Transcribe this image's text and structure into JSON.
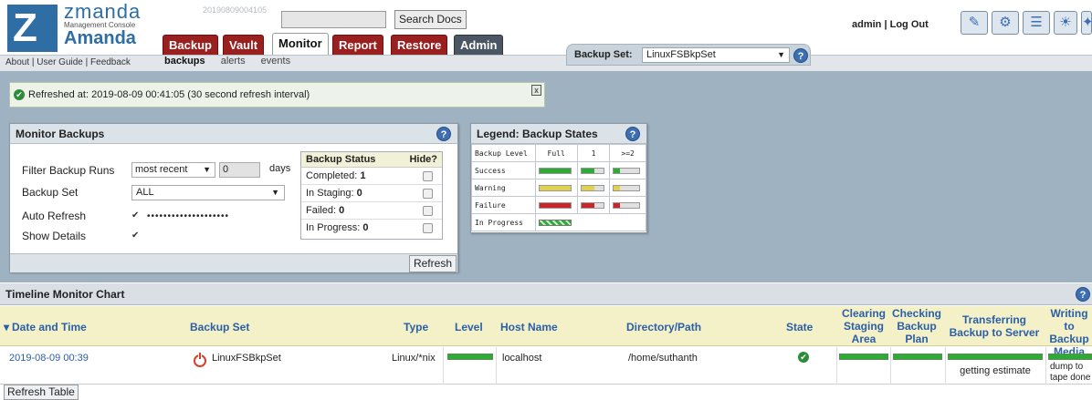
{
  "header": {
    "logo": {
      "line1": "zmanda",
      "line2": "Management Console",
      "line3": "Amanda"
    },
    "build_id": "20190809004105",
    "search_button": "Search Docs",
    "tabs": [
      "Backup",
      "Vault",
      "Monitor",
      "Report",
      "Restore",
      "Admin"
    ],
    "active_tab": "Monitor",
    "sublinks": "About | User Guide | Feedback",
    "subnav": [
      "backups",
      "alerts",
      "events"
    ],
    "backup_set_label": "Backup Set:",
    "backup_set_value": "LinuxFSBkpSet",
    "user_label": "admin",
    "separator": "|",
    "logout": "Log Out",
    "help_glyph": "?"
  },
  "refresh": {
    "message": "Refreshed at: 2019-08-09 00:41:05 (30 second refresh interval)",
    "close": "x"
  },
  "monitor": {
    "title": "Monitor Backups",
    "filter_label": "Filter Backup Runs",
    "filter_value": "most recent",
    "filter_days": "0",
    "days_label": "days",
    "backup_set_label": "Backup Set",
    "backup_set_value": "ALL",
    "auto_refresh_label": "Auto Refresh",
    "show_details_label": "Show Details",
    "masked": "••••••••••••••••••••",
    "status_header": "Backup Status",
    "hide_header": "Hide?",
    "status": [
      {
        "label": "Completed:",
        "value": "1"
      },
      {
        "label": "In Staging:",
        "value": "0"
      },
      {
        "label": "Failed:",
        "value": "0"
      },
      {
        "label": "In Progress:",
        "value": "0"
      }
    ],
    "refresh_button": "Refresh"
  },
  "legend": {
    "title": "Legend: Backup States",
    "col_level": "Backup Level",
    "col_full": "Full",
    "col_1": "1",
    "col_2": ">=2",
    "rows": [
      "Success",
      "Warning",
      "Failure",
      "In Progress"
    ],
    "colors": {
      "success": "#2eab34",
      "warning": "#e0d24a",
      "failure": "#c8262b"
    }
  },
  "timeline": {
    "title": "Timeline Monitor Chart",
    "columns": {
      "date": "Date and Time",
      "backup_set": "Backup Set",
      "type": "Type",
      "level": "Level",
      "host": "Host Name",
      "path": "Directory/Path",
      "state": "State",
      "clearing": "Clearing Staging Area",
      "checking": "Checking Backup Plan",
      "transferring": "Transferring Backup to Server",
      "writing": "Writing to Backup Media"
    },
    "row": {
      "date": "2019-08-09 00:39",
      "backup_set": "LinuxFSBkpSet",
      "type": "Linux/*nix",
      "host": "localhost",
      "path": "/home/suthanth",
      "transfer_note": "getting estimate",
      "write_note": "dump to tape done"
    },
    "refresh_table": "Refresh Table"
  }
}
